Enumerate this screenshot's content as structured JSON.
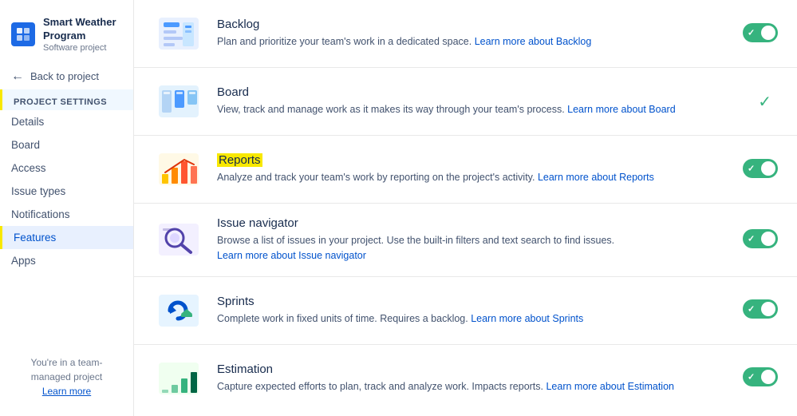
{
  "sidebar": {
    "project_name": "Smart Weather Program",
    "project_type": "Software project",
    "back_label": "Back to project",
    "section_label": "Project settings",
    "nav_items": [
      {
        "id": "details",
        "label": "Details",
        "active": false
      },
      {
        "id": "board",
        "label": "Board",
        "active": false
      },
      {
        "id": "access",
        "label": "Access",
        "active": false
      },
      {
        "id": "issue-types",
        "label": "Issue types",
        "active": false
      },
      {
        "id": "notifications",
        "label": "Notifications",
        "active": false
      },
      {
        "id": "features",
        "label": "Features",
        "active": true
      },
      {
        "id": "apps",
        "label": "Apps",
        "active": false
      }
    ],
    "footer_text": "You're in a team-managed project",
    "learn_more": "Learn more"
  },
  "features": [
    {
      "id": "backlog",
      "title": "Backlog",
      "title_highlighted": false,
      "desc": "Plan and prioritize your team's work in a dedicated space.",
      "link_text": "Learn more about Backlog",
      "link_id": "backlog-link",
      "toggle": "on",
      "show_checkmark": false
    },
    {
      "id": "board",
      "title": "Board",
      "title_highlighted": false,
      "desc": "View, track and manage work as it makes its way through your team's process.",
      "link_text": "Learn more about Board",
      "link_id": "board-link",
      "toggle": null,
      "show_checkmark": true
    },
    {
      "id": "reports",
      "title": "Reports",
      "title_highlighted": true,
      "desc": "Analyze and track your team's work by reporting on the project's activity.",
      "link_text": "Learn more about Reports",
      "link_id": "reports-link",
      "toggle": "on",
      "show_checkmark": false
    },
    {
      "id": "issue-navigator",
      "title": "Issue navigator",
      "title_highlighted": false,
      "desc": "Browse a list of issues in your project. Use the built-in filters and text search to find issues.",
      "link_text": "Learn more about Issue navigator",
      "link_id": "issue-nav-link",
      "toggle": "on",
      "show_checkmark": false
    },
    {
      "id": "sprints",
      "title": "Sprints",
      "title_highlighted": false,
      "desc": "Complete work in fixed units of time. Requires a backlog.",
      "link_text": "Learn more about Sprints",
      "link_id": "sprints-link",
      "toggle": "on",
      "show_checkmark": false
    },
    {
      "id": "estimation",
      "title": "Estimation",
      "title_highlighted": false,
      "desc": "Capture expected efforts to plan, track and analyze work. Impacts reports.",
      "link_text": "Learn more about Estimation",
      "link_id": "estimation-link",
      "toggle": "on",
      "show_checkmark": false
    }
  ],
  "colors": {
    "toggle_on": "#36b37e",
    "toggle_off": "#dfe1e6",
    "highlight": "#f8e800",
    "link": "#0052cc"
  }
}
